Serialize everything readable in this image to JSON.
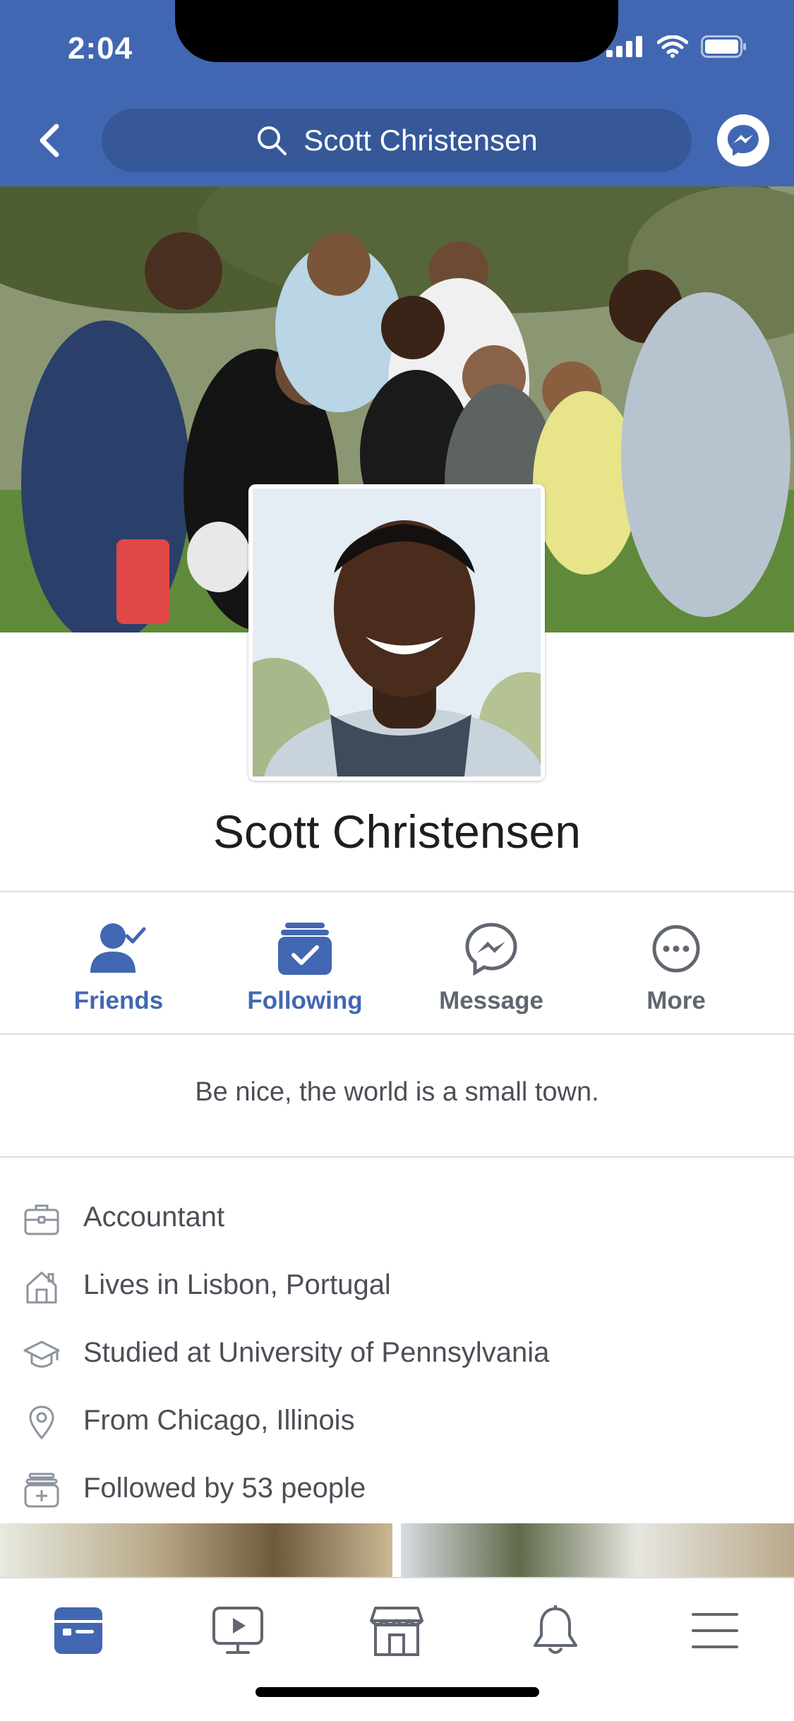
{
  "status_bar": {
    "time": "2:04"
  },
  "header": {
    "search_query": "Scott Christensen",
    "back_icon": "chevron-left-icon",
    "messenger_icon": "messenger-icon"
  },
  "profile": {
    "name": "Scott Christensen",
    "bio": "Be nice, the world is a small town."
  },
  "actions": [
    {
      "label": "Friends",
      "icon": "friends-check-icon",
      "active": true
    },
    {
      "label": "Following",
      "icon": "following-check-icon",
      "active": true
    },
    {
      "label": "Message",
      "icon": "messenger-icon",
      "active": false
    },
    {
      "label": "More",
      "icon": "more-dots-icon",
      "active": false
    }
  ],
  "details": [
    {
      "icon": "briefcase-icon",
      "text": "Accountant"
    },
    {
      "icon": "home-icon",
      "text": "Lives in Lisbon, Portugal"
    },
    {
      "icon": "graduation-cap-icon",
      "text": "Studied at University of Pennsylvania"
    },
    {
      "icon": "location-pin-icon",
      "text": "From Chicago, Illinois"
    },
    {
      "icon": "followers-icon",
      "text": "Followed by 53 people"
    }
  ],
  "tab_bar": [
    {
      "icon": "news-feed-icon",
      "active": true
    },
    {
      "icon": "watch-icon",
      "active": false
    },
    {
      "icon": "marketplace-icon",
      "active": false
    },
    {
      "icon": "notifications-bell-icon",
      "active": false
    },
    {
      "icon": "menu-icon",
      "active": false
    }
  ],
  "colors": {
    "brand_blue": "#4267b2",
    "search_pill": "#365899",
    "text_primary": "#1c1e21",
    "text_secondary": "#606770"
  }
}
